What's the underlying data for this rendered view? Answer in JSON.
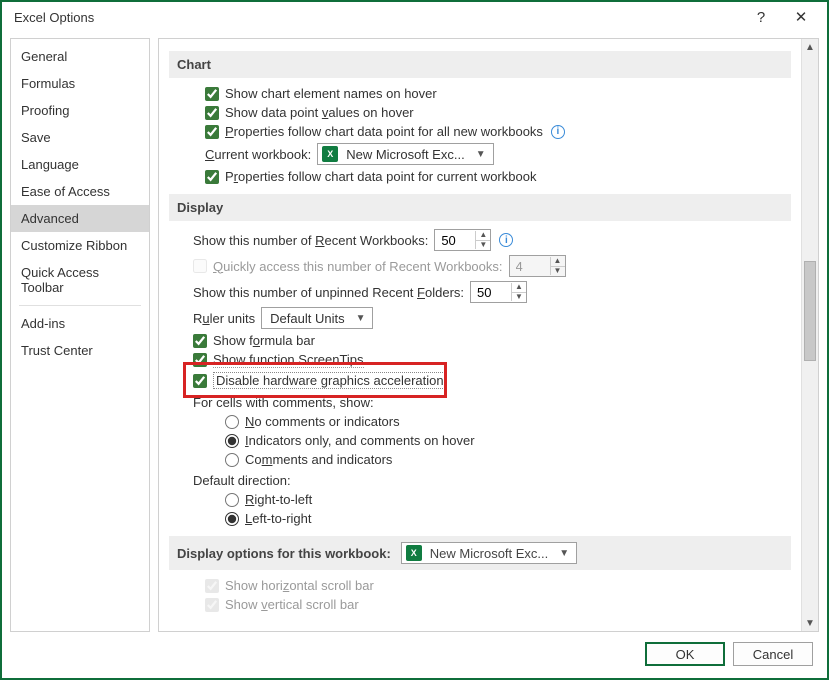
{
  "titlebar": {
    "title": "Excel Options",
    "help": "?",
    "close": "✕"
  },
  "sidebar": {
    "items": [
      {
        "label": "General"
      },
      {
        "label": "Formulas"
      },
      {
        "label": "Proofing"
      },
      {
        "label": "Save"
      },
      {
        "label": "Language"
      },
      {
        "label": "Ease of Access"
      },
      {
        "label": "Advanced",
        "selected": true
      },
      {
        "label": "Customize Ribbon"
      },
      {
        "label": "Quick Access Toolbar"
      },
      {
        "label": "Add-ins"
      },
      {
        "label": "Trust Center"
      }
    ]
  },
  "sections": {
    "chart": {
      "header": "Chart",
      "opt_show_element_names": "Show chart element names on hover",
      "opt_show_data_points": "Show data point values on hover",
      "opt_props_all": "Properties follow chart data point for all new workbooks",
      "current_workbook_label": "Current workbook:",
      "current_workbook_value": "New Microsoft Exc...",
      "opt_props_current": "Properties follow chart data point for current workbook"
    },
    "display": {
      "header": "Display",
      "recent_workbooks_label": "Show this number of Recent Workbooks:",
      "recent_workbooks_value": "50",
      "quick_access_label": "Quickly access this number of Recent Workbooks:",
      "quick_access_value": "4",
      "recent_folders_label": "Show this number of unpinned Recent Folders:",
      "recent_folders_value": "50",
      "ruler_units_label": "Ruler units",
      "ruler_units_value": "Default Units",
      "formula_bar": "Show formula bar",
      "screentips": "Show function ScreenTips",
      "disable_hw": "Disable hardware graphics acceleration",
      "comments_header": "For cells with comments, show:",
      "comments_none": "No comments or indicators",
      "comments_indicators": "Indicators only, and comments on hover",
      "comments_both": "Comments and indicators",
      "default_dir_header": "Default direction:",
      "dir_rtl": "Right-to-left",
      "dir_ltr": "Left-to-right"
    },
    "display_workbook": {
      "header": "Display options for this workbook:",
      "value": "New Microsoft Exc...",
      "h_scroll": "Show horizontal scroll bar",
      "v_scroll": "Show vertical scroll bar"
    }
  },
  "footer": {
    "ok": "OK",
    "cancel": "Cancel"
  }
}
